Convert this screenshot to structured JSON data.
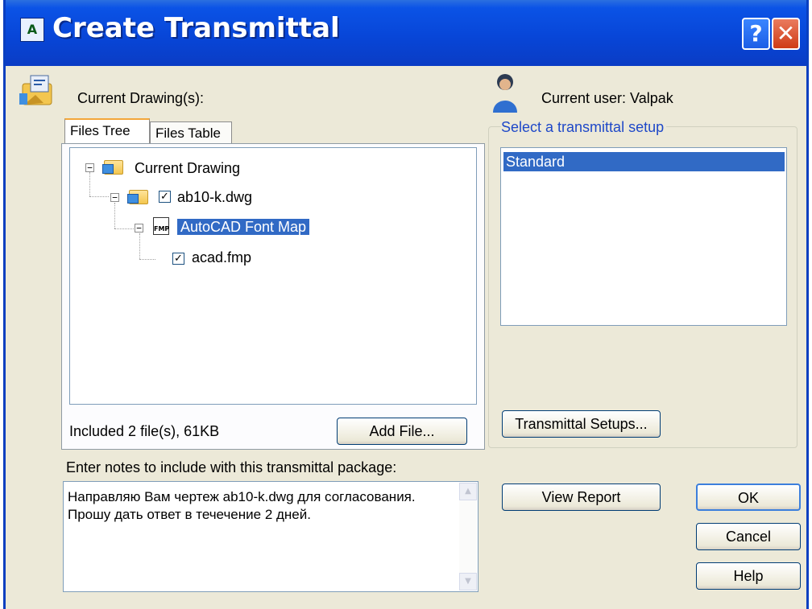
{
  "window": {
    "title": "Create Transmittal",
    "help_label": "?",
    "close_label": "✕"
  },
  "left": {
    "current_drawings_label": "Current Drawing(s):",
    "tabs": [
      {
        "label": "Files Tree",
        "active": true
      },
      {
        "label": "Files Table",
        "active": false
      }
    ],
    "tree": [
      {
        "label": "Current Drawing",
        "level": 0,
        "expanded": true
      },
      {
        "label": "ab10-k.dwg",
        "level": 1,
        "checked": true,
        "expanded": true
      },
      {
        "label": "AutoCAD Font Map",
        "level": 2,
        "selected": true,
        "expanded": true
      },
      {
        "label": "acad.fmp",
        "level": 3,
        "checked": true
      }
    ],
    "included_text": "Included 2 file(s), 61KB",
    "add_file_label": "Add File...",
    "notes_label": "Enter notes to include with this transmittal package:",
    "notes_text": "Направляю Вам чертеж ab10-k.dwg для согласования. Прошу дать ответ в течечение 2 дней."
  },
  "right": {
    "current_user_label": "Current user: Valpak",
    "select_setup_label": "Select a transmittal setup",
    "setups": [
      "Standard"
    ],
    "transmittal_setups_label": "Transmittal Setups...",
    "view_report_label": "View Report",
    "ok_label": "OK",
    "cancel_label": "Cancel",
    "help_label": "Help"
  },
  "colors": {
    "title_bar": "#0846d8",
    "selection": "#316ac5",
    "window_bg": "#ece9d8",
    "link_blue": "#1e48c8"
  }
}
